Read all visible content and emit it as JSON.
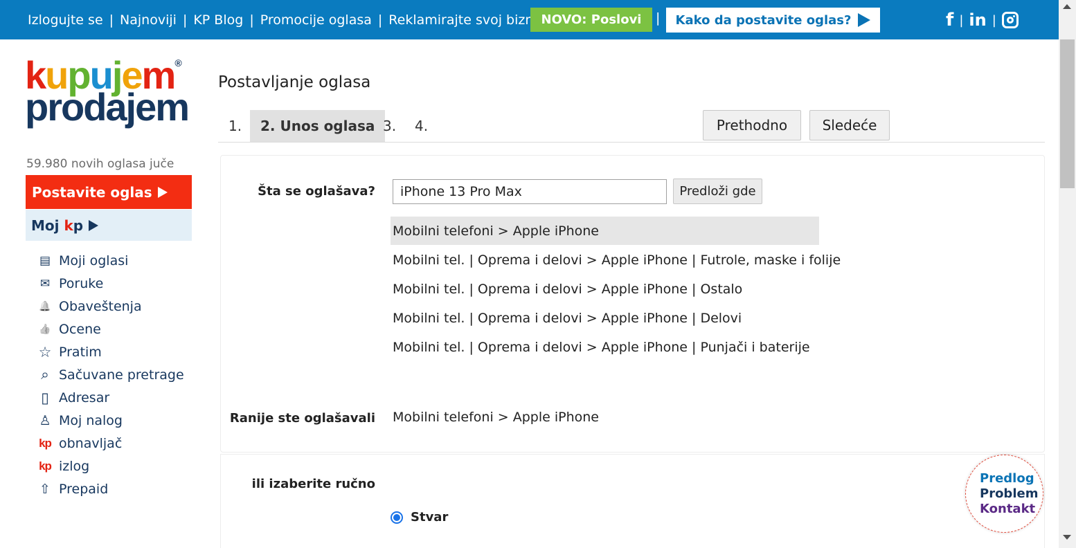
{
  "topbar": {
    "links": [
      "Izlogujte se",
      "Najnoviji",
      "KP Blog",
      "Promocije oglasa",
      "Reklamirajte svoj biznis"
    ],
    "novo_label": "NOVO: Poslovi",
    "kako_label": "Kako da postavite oglas?",
    "social": [
      "facebook-icon",
      "linkedin-icon",
      "instagram-icon"
    ],
    "fb_glyph": "f",
    "in_glyph": "in"
  },
  "brand": {
    "line1": [
      "k",
      "u",
      "p",
      "u",
      "j",
      "e",
      "m"
    ],
    "line2": "prodajem",
    "reg": "®",
    "colors": {
      "letters": [
        "#e32313",
        "#f0a30a",
        "#62b230",
        "#1b8fd0",
        "#62b230",
        "#f0a30a",
        "#e32313"
      ],
      "navy": "#17375e",
      "topbar": "#0a7bbf",
      "red": "#f32d12",
      "green": "#7cc242"
    }
  },
  "sidebar": {
    "stats": "59.980 novih oglasa juče",
    "post_button": "Postavite oglas",
    "moj_kp_prefix": "Moj ",
    "moj_kp_k": "k",
    "moj_kp_p": "p",
    "items": [
      {
        "label": "Moji oglasi",
        "icon": "list-icon",
        "glyph": "▤"
      },
      {
        "label": "Poruke",
        "icon": "messages-icon",
        "glyph": "✉"
      },
      {
        "label": "Obaveštenja",
        "icon": "bell-icon",
        "glyph": "🔔"
      },
      {
        "label": "Ocene",
        "icon": "thumbs-up-icon",
        "glyph": "👍"
      },
      {
        "label": "Pratim",
        "icon": "star-icon",
        "glyph": "☆"
      },
      {
        "label": "Sačuvane pretrage",
        "icon": "saved-search-icon",
        "glyph": "⌕"
      },
      {
        "label": "Adresar",
        "icon": "address-book-icon",
        "glyph": "▯"
      },
      {
        "label": "Moj nalog",
        "icon": "user-icon",
        "glyph": "♙"
      },
      {
        "label": "obnavljač",
        "icon": "kp-logo-icon",
        "glyph": "kp"
      },
      {
        "label": "izlog",
        "icon": "kp-logo-icon",
        "glyph": "kp"
      },
      {
        "label": "Prepaid",
        "icon": "upload-arrow-icon",
        "glyph": "⇧"
      }
    ]
  },
  "main": {
    "title": "Postavljanje oglasa",
    "steps": [
      "1.",
      "2. Unos oglasa",
      "3.",
      "4."
    ],
    "prev_button": "Prethodno",
    "next_button": "Sledeće",
    "ad_label": "Šta se oglašava?",
    "ad_value": "iPhone 13 Pro Max",
    "suggest_button": "Predloži gde",
    "suggestions": [
      "Mobilni telefoni > Apple iPhone",
      "Mobilni tel. | Oprema i delovi > Apple iPhone | Futrole, maske i folije",
      "Mobilni tel. | Oprema i delovi > Apple iPhone | Ostalo",
      "Mobilni tel. | Oprema i delovi > Apple iPhone | Delovi",
      "Mobilni tel. | Oprema i delovi > Apple iPhone | Punjači i baterije"
    ],
    "earlier_label": "Ranije ste oglašavali",
    "earlier_value": "Mobilni telefoni > Apple iPhone",
    "manual_label": "ili izaberite ručno",
    "radio_label": "Stvar"
  },
  "feedback": {
    "line1": "Predlog",
    "line2": "Problem",
    "line3": "Kontakt"
  }
}
